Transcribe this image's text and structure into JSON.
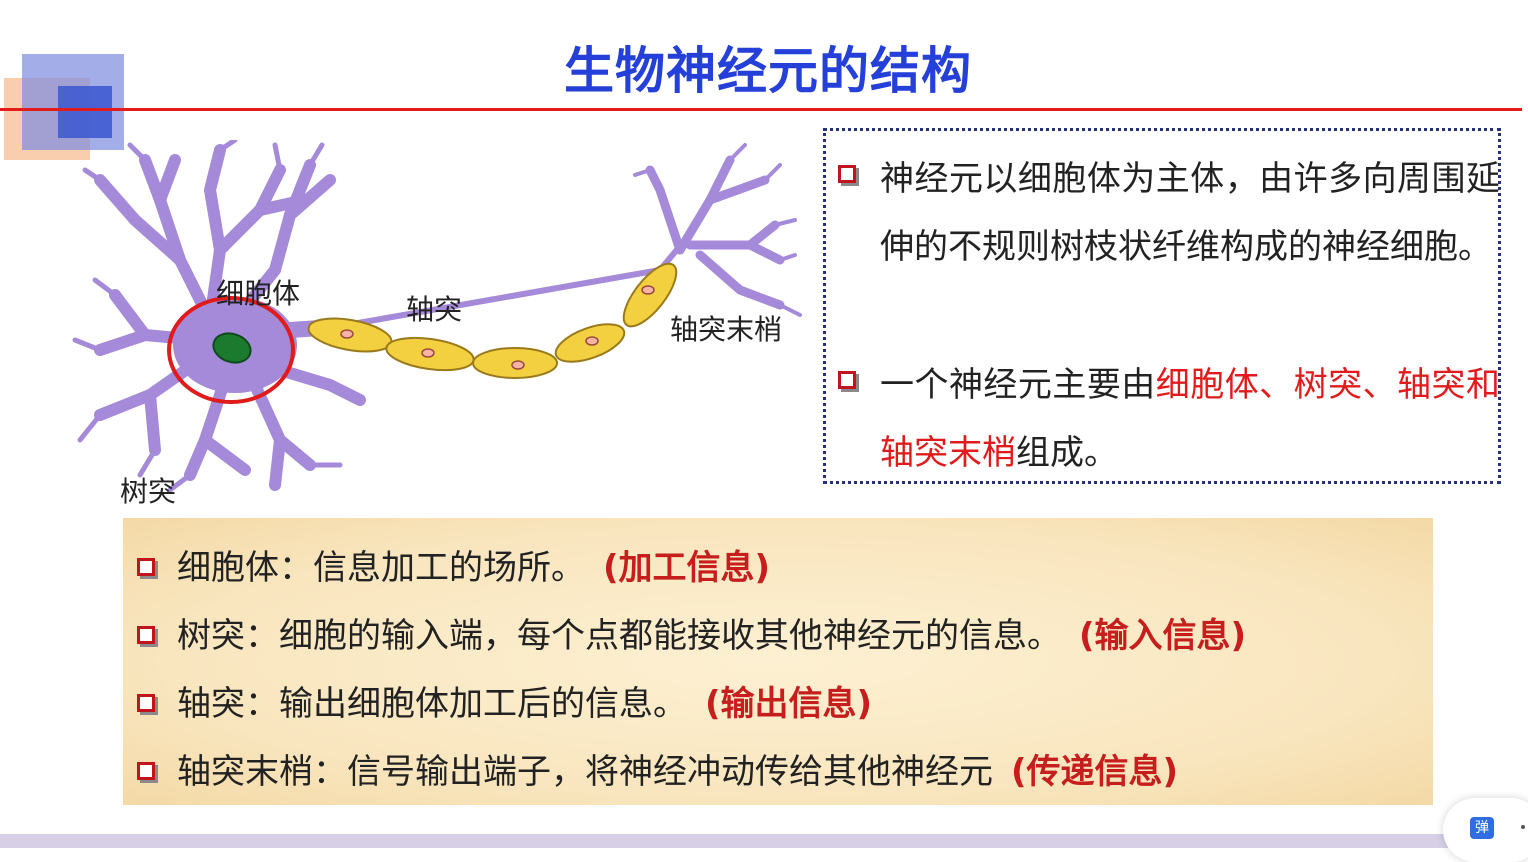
{
  "slide": {
    "title": "生物神经元的结构"
  },
  "diagram": {
    "labels": {
      "soma": "细胞体",
      "axon": "轴突",
      "axon_terminal": "轴突末梢",
      "dendrite": "树突"
    },
    "colors": {
      "neuron_body": "#a48ad9",
      "nucleus": "#1c7a2f",
      "myelin": "#f3d040",
      "highlight_circle": "#e01b1b"
    }
  },
  "infobox": {
    "items": [
      {
        "text": "神经元以细胞体为主体，由许多向周围延伸的不规则树枝状纤维构成的神经细胞。"
      },
      {
        "before": "一个神经元主要由",
        "highlight": "细胞体、树突、轴突和轴突末梢",
        "after": "组成。"
      }
    ]
  },
  "parts": [
    {
      "text": "细胞体：信息加工的场所。",
      "tag": "(加工信息)"
    },
    {
      "text": "树突：细胞的输入端，每个点都能接收其他神经元的信息。",
      "tag": "(输入信息)"
    },
    {
      "text": "轴突：输出细胞体加工后的信息。",
      "tag": "(输出信息)"
    },
    {
      "text": "轴突末梢：信号输出端子，将神经冲动传给其他神经元",
      "tag": "(传递信息)"
    }
  ],
  "floating_button": {
    "label": "弹"
  },
  "colors": {
    "title": "#2540d8",
    "rule": "#e21b1b",
    "highlight": "#e11b1b",
    "tag": "#c61d1d",
    "box_border": "#27307a"
  }
}
